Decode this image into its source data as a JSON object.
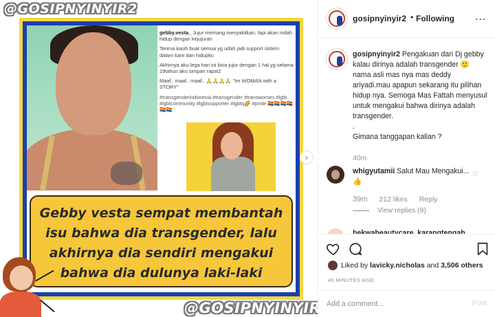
{
  "media": {
    "watermark_top": "@GOSIPNYINYIR2",
    "watermark_bottom": "@GOSIPNYINYIR2",
    "embedded_caption": {
      "user": "gebby.vesta_",
      "p1": "Jujur memang menyakitkan, tapi akan indah hidup dengan kejujuran",
      "p2": "Terima kasih buat semua yg udah jadi support sistem dalam karir dan hidupku",
      "p3": "Akhirnya aku lega hari ini bisa jujur dengan 1 hal yg selama 19tahun aku simpan rapat2",
      "p4": "Maaf.. maaf.. maaf.. 🙏🙏🙏🙏 \"Im WOMAN with a STORY\"",
      "tags": "#transgenderindonesia #transgender #transwomen #lgbt #lgbtcommunity #lgbtsupporter #lgbtq🌈 #pride 🏳️‍🌈🏳️‍🌈🏳️‍🌈🏳️‍🌈🏳️‍🌈🏳️‍🌈"
    },
    "banner_lines": [
      "Gebby vesta sempat membantah",
      "isu bahwa dia transgender, lalu",
      "akhirnya dia sendiri mengakui",
      "bahwa dia dulunya laki-laki"
    ],
    "next_arrow": "›"
  },
  "header": {
    "username": "gosipnyinyir2",
    "separator": "•",
    "follow_status": "Following",
    "more": "..."
  },
  "caption": {
    "username": "gosipnyinyir2",
    "text": "Pengakuan dari Dj gebby kalau dirinya adalah transgender 🙂 nama asli mas nya mas deddy ariyadi.mau apapun sekarang itu pilihan hidup nya. Semoga Mas Fattah menyusul untuk mengakui bahwa dirinya adalah transgender.",
    "dot": ".",
    "question": "Gimana tanggapan kalian ?",
    "time": "40m"
  },
  "comment": {
    "username": "whigyutamii",
    "text": "Salut Mau Mengakui... 👍",
    "time": "39m",
    "likes": "212 likes",
    "reply": "Reply",
    "view_replies": "View replies (9)"
  },
  "comment2": {
    "username": "bekwabeautycare_karangtengah"
  },
  "actions": {
    "liked_by_prefix": "Liked by",
    "liked_by_user": "lavicky.nicholas",
    "liked_by_and": "and",
    "liked_by_count": "3,506 others",
    "post_time": "40 MINUTES AGO"
  },
  "add_comment": {
    "placeholder": "Add a comment...",
    "post_label": "Post"
  }
}
